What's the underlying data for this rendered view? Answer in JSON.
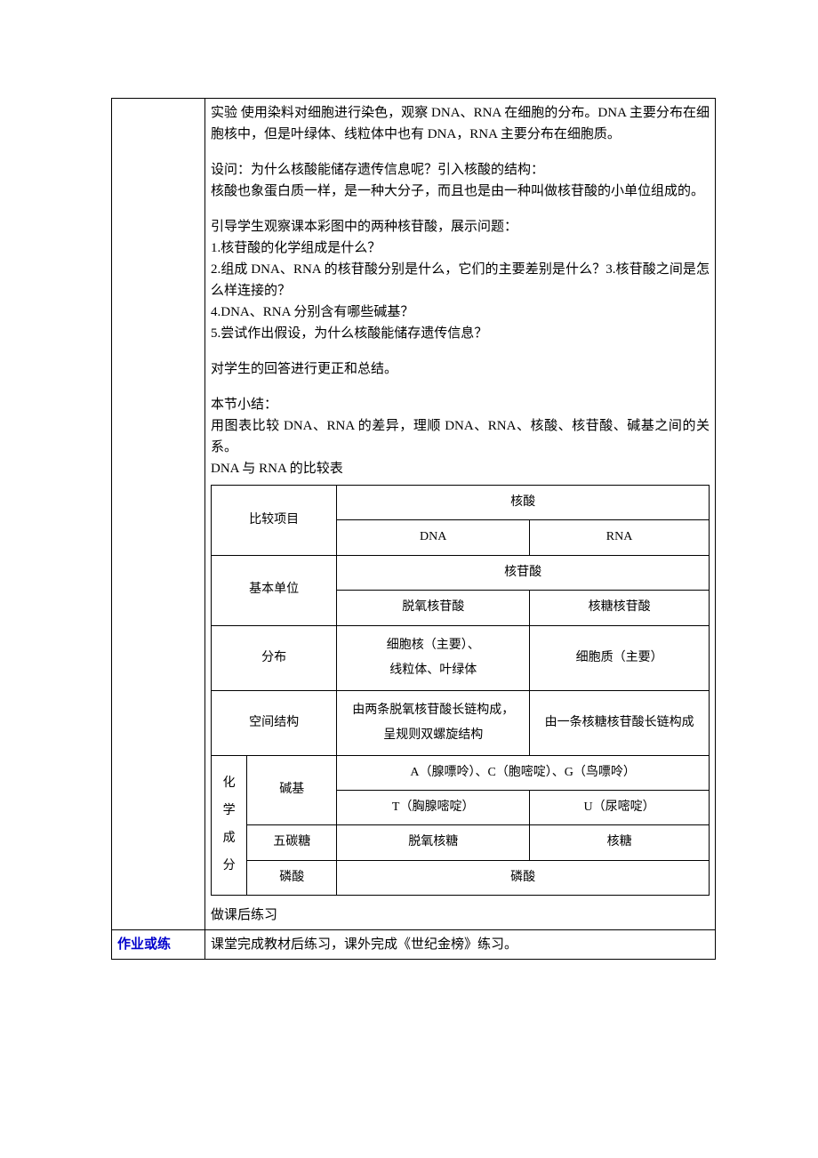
{
  "main": {
    "p1": "实验 使用染料对细胞进行染色，观察 DNA、RNA 在细胞的分布。DNA 主要分布在细胞核中，但是叶绿体、线粒体中也有 DNA，RNA 主要分布在细胞质。",
    "p2a": "设问：为什么核酸能储存遗传信息呢？引入核酸的结构：",
    "p2b": "核酸也象蛋白质一样，是一种大分子，而且也是由一种叫做核苷酸的小单位组成的。",
    "p3_lead": "引导学生观察课本彩图中的两种核苷酸，展示问题：",
    "q1": "1.核苷酸的化学组成是什么？",
    "q2": "2.组成 DNA、RNA 的核苷酸分别是什么，它们的主要差别是什么？3.核苷酸之间是怎么样连接的？",
    "q4": "4.DNA、RNA 分别含有哪些碱基？",
    "q5": "5.尝试作出假设，为什么核酸能储存遗传信息？",
    "p5": "对学生的回答进行更正和总结。",
    "p6a": "本节小结：",
    "p6b": "用图表比较 DNA、RNA 的差异，理顺 DNA、RNA、核酸、核苷酸、碱基之间的关系。",
    "p6c": "DNA 与 RNA 的比较表",
    "practice": "做课后练习"
  },
  "table": {
    "r1c1": "比较项目",
    "r1c2": "核酸",
    "r2c1": "DNA",
    "r2c2": "RNA",
    "r3c1": "基本单位",
    "r3c2": "核苷酸",
    "r4c1": "脱氧核苷酸",
    "r4c2": "核糖核苷酸",
    "r5c1": "分布",
    "r5c2a": "细胞核（主要）、",
    "r5c2b": "线粒体、叶绿体",
    "r5c3": "细胞质（主要）",
    "r6c1": "空间结构",
    "r6c2a": "由两条脱氧核苷酸长链构成，",
    "r6c2b": "呈规则双螺旋结构",
    "r6c3": "由一条核糖核苷酸长链构成",
    "r7c1": "化学成分",
    "r7c2": "碱基",
    "r7c3": "A（腺嘌呤）、C（胞嘧啶）、G（鸟嘌呤）",
    "r8c1": "T（胸腺嘧啶）",
    "r8c2": "U（尿嘧啶）",
    "r9c1": "五碳糖",
    "r9c2": "脱氧核糖",
    "r9c3": "核糖",
    "r10c1": "磷酸",
    "r10c2": "磷酸"
  },
  "homework": {
    "label": "作业或练",
    "text": "课堂完成教材后练习，课外完成《世纪金榜》练习。"
  }
}
